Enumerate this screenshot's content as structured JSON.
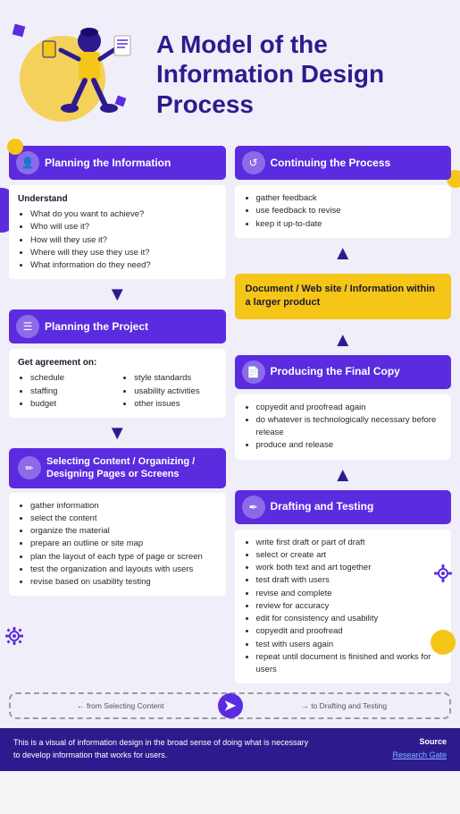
{
  "header": {
    "title": "A Model of the Information Design Process"
  },
  "sections": {
    "planning_info": {
      "title": "Planning the Information",
      "understand_label": "Understand",
      "bullets": [
        "What do you want to achieve?",
        "Who will use it?",
        "How will they use it?",
        "Where will they use they use it?",
        "What information do they need?"
      ]
    },
    "continuing": {
      "title": "Continuing the Process",
      "bullets": [
        "gather feedback",
        "use feedback to revise",
        "keep it up-to-date"
      ]
    },
    "planning_project": {
      "title": "Planning the Project",
      "agreement_label": "Get agreement on:",
      "col1": [
        "schedule",
        "staffing",
        "budget"
      ],
      "col2": [
        "style standards",
        "usability activities",
        "other issues"
      ]
    },
    "producing": {
      "title": "Producing the Final Copy",
      "bullets": [
        "copyedit and proofread again",
        "do whatever is technologically necessary before release",
        "produce and release"
      ]
    },
    "selecting": {
      "title": "Selecting Content / Organizing / Designing Pages or Screens",
      "bullets": [
        "gather information",
        "select the content",
        "organize the material",
        "prepare an outline or site map",
        "plan the layout of each type of page or screen",
        "test the organization and layouts with users",
        "revise based on usability testing"
      ]
    },
    "drafting": {
      "title": "Drafting and Testing",
      "bullets": [
        "write first draft or part of draft",
        "select or create art",
        "work both text and art together",
        "test draft with users",
        "revise and complete",
        "review for accuracy",
        "edit for consistency and usability",
        "copyedit and proofread",
        "test with users again",
        "repeat until document is finished and works for users"
      ]
    },
    "document_box": {
      "text": "Document / Web site / Information within a larger product"
    }
  },
  "footer": {
    "left_text": "This is a visual of information design in the broad sense of doing what is necessary to develop information that works for users.",
    "source_label": "Source",
    "source_link": "Research Gate"
  },
  "icons": {
    "person": "👤",
    "refresh": "↺",
    "document": "📄",
    "list": "☰",
    "edit": "✏",
    "pencil": "✒"
  }
}
